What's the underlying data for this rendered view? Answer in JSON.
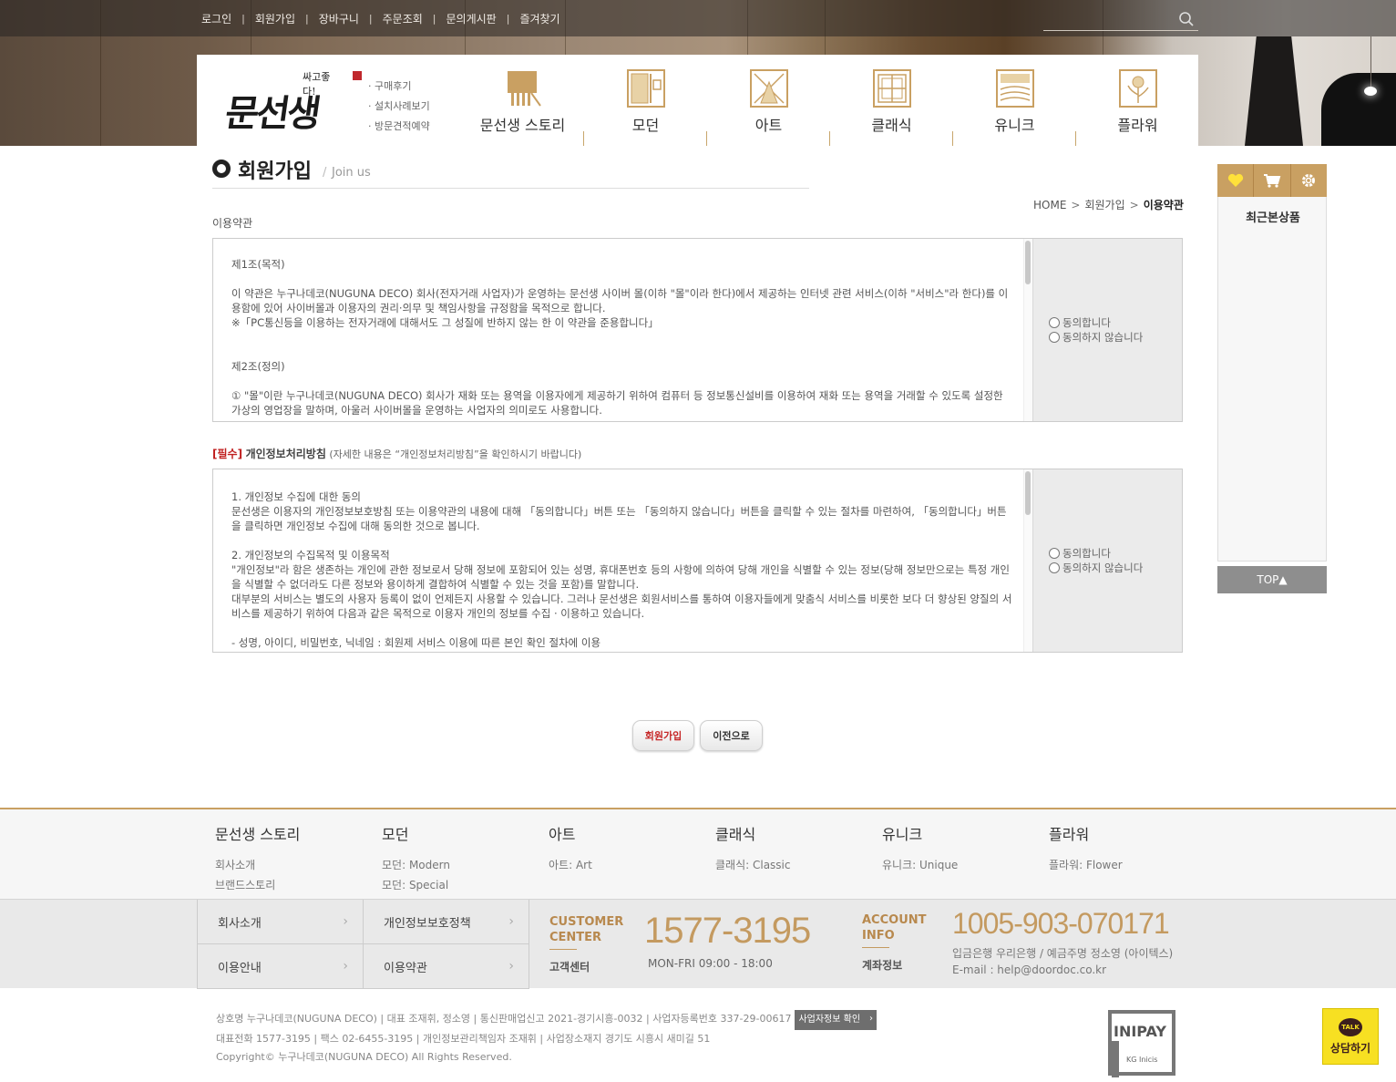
{
  "top_links": [
    "로그인",
    "회원가입",
    "장바구니",
    "주문조회",
    "문의게시판",
    "즐겨찾기"
  ],
  "search": {
    "placeholder": ""
  },
  "logo": {
    "tagline": "싸고좋다!",
    "name": "문선생"
  },
  "sub_links": [
    "· 구매후기",
    "· 설치사례보기",
    "· 방문견적예약"
  ],
  "categories": [
    "문선생 스토리",
    "모던",
    "아트",
    "클래식",
    "유니크",
    "플라워"
  ],
  "page_title": {
    "main": "회원가입",
    "slash": "/",
    "sub": "Join us"
  },
  "breadcrumb": {
    "home": "HOME",
    "sep": ">",
    "level1": "회원가입",
    "current": "이용약관"
  },
  "terms": {
    "heading": "이용약관",
    "body": "제1조(목적)\n\n이 약관은 누구나데코(NUGUNA DECO) 회사(전자거래 사업자)가 운영하는 문선생 사이버 몰(이하 \"몰\"이라 한다)에서 제공하는 인터넷 관련 서비스(이하 \"서비스\"라 한다)를 이용함에 있어 사이버몰과 이용자의 권리·의무 및 책임사항을 규정함을 목적으로 합니다.\n※「PC통신등을 이용하는 전자거래에 대해서도 그 성질에 반하지 않는 한 이 약관을 준용합니다」\n\n\n제2조(정의)\n\n① \"몰\"이란 누구나데코(NUGUNA DECO) 회사가 재화 또는 용역을 이용자에게 제공하기 위하여 컴퓨터 등 정보통신설비를 이용하여 재화 또는 용역을 거래할 수 있도록 설정한 가상의 영업장을 말하며, 아울러 사이버몰을 운영하는 사업자의 의미로도 사용합니다.",
    "agree": "동의합니다",
    "disagree": "동의하지 않습니다"
  },
  "privacy": {
    "required": "[필수]",
    "title": "개인정보처리방침",
    "note": "(자세한 내용은 “개인정보처리방침”을 확인하시기 바랍니다)",
    "body": "1. 개인정보 수집에 대한 동의\n문선생은 이용자의 개인정보보호방침 또는 이용약관의 내용에 대해 「동의합니다」버튼 또는 「동의하지 않습니다」버튼을 클릭할 수 있는 절차를 마련하여, 「동의합니다」버튼을 클릭하면 개인정보 수집에 대해 동의한 것으로 봅니다.\n\n2. 개인정보의 수집목적 및 이용목적\n\"개인정보\"라 함은 생존하는 개인에 관한 정보로서 당해 정보에 포함되어 있는 성명, 휴대폰번호 등의 사항에 의하여 당해 개인을 식별할 수 있는 정보(당해 정보만으로는 특정 개인을 식별할 수 없더라도 다른 정보와 용이하게 결합하여 식별할 수 있는 것을 포함)를 말합니다.\n대부분의 서비스는 별도의 사용자 등록이 없이 언제든지 사용할 수 있습니다. 그러나 문선생은 회원서비스를 통하여 이용자들에게 맞춤식 서비스를 비롯한 보다 더 향상된 양질의 서비스를 제공하기 위하여 다음과 같은 목적으로 이용자 개인의 정보를 수집 · 이용하고 있습니다.\n\n- 성명, 아이디, 비밀번호, 닉네임 : 회원제 서비스 이용에 따른 본인 확인 절차에 이용",
    "agree": "동의합니다",
    "disagree": "동의하지 않습니다"
  },
  "buttons": {
    "join": "회원가입",
    "back": "이전으로"
  },
  "quick": {
    "title": "최근본상품",
    "top": "TOP▲"
  },
  "footer_nav": [
    {
      "title": "문선생 스토리",
      "items": [
        "회사소개",
        "브랜드스토리"
      ]
    },
    {
      "title": "모던",
      "items": [
        "모던: Modern",
        "모던: Special"
      ]
    },
    {
      "title": "아트",
      "items": [
        "아트: Art"
      ]
    },
    {
      "title": "클래식",
      "items": [
        "클래식: Classic"
      ]
    },
    {
      "title": "유니크",
      "items": [
        "유니크: Unique"
      ]
    },
    {
      "title": "플라워",
      "items": [
        "플라워: Flower"
      ]
    }
  ],
  "footer_links": [
    "회사소개",
    "개인정보보호정책",
    "이용안내",
    "이용약관"
  ],
  "customer": {
    "label1": "CUSTOMER",
    "label2": "CENTER",
    "kor": "고객센터",
    "phone": "1577-3195",
    "hours": "MON-FRI 09:00 - 18:00"
  },
  "account": {
    "label1": "ACCOUNT",
    "label2": "INFO",
    "kor": "계좌정보",
    "number": "1005-903-070171",
    "bank": "입금은행 우리은행 / 예금주명 정소영 (아이텍스)",
    "email": "E-mail : help@doordoc.co.kr"
  },
  "copyright": {
    "line1": "상호명 누구나데코(NUGUNA DECO) | 대표 조재휘, 정소영 | 통신판매업신고 2021-경기시흥-0032 | 사업자등록번호 337-29-00617",
    "biz_btn": "사업자정보 확인",
    "line2": "대표전화 1577-3195 | 팩스 02-6455-3195 | 개인정보관리책임자 조재휘 | 사업장소재지 경기도 시흥시 새미길 51",
    "line3": "Copyright© 누구나데코(NUGUNA DECO) All Rights Reserved."
  },
  "inipay": {
    "name": "INIPAY",
    "sub": "KG Inicis"
  },
  "talk": {
    "bubble": "TALK",
    "label": "상담하기"
  },
  "colors": {
    "accent": "#c9a062",
    "required": "#c01f1f",
    "join_text": "#c62828"
  }
}
